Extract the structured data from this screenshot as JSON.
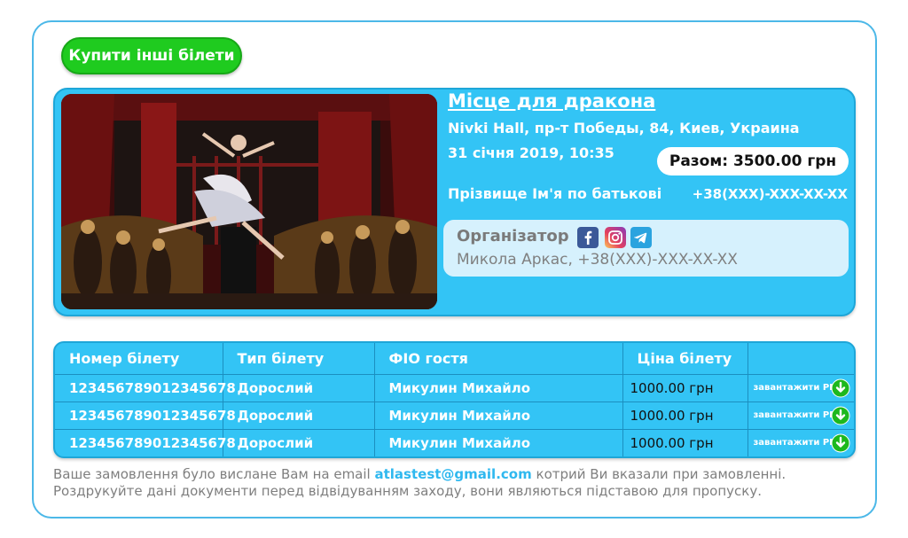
{
  "actions": {
    "buy_other_label": "Купити інші білети"
  },
  "event": {
    "title": "Місце для дракона",
    "address": "Nivki Hall, пр-т Победы, 84, Киев, Украина",
    "datetime": "31 січня 2019, 10:35",
    "total": "Разом: 3500.00 грн",
    "guest_name": "Прізвище Ім'я по батькові",
    "guest_phone": "+38(XXX)-XXX-XX-XX",
    "image_icon": "ballet-performance-photo"
  },
  "organizer": {
    "label": "Організатор",
    "contact": "Микола Аркас, +38(XXX)-XXX-XX-XX",
    "socials": [
      "facebook-icon",
      "instagram-icon",
      "telegram-icon"
    ]
  },
  "tickets": {
    "headers": [
      "Номер білету",
      "Тип білету",
      "ФІО гостя",
      "Ціна білету",
      ""
    ],
    "download_label": "завантажити PDF",
    "rows": [
      {
        "number": "123456789012345678",
        "type": "Дорослий",
        "guest": "Микулин Михайло",
        "price": "1000.00 грн"
      },
      {
        "number": "123456789012345678",
        "type": "Дорослий",
        "guest": "Микулин Михайло",
        "price": "1000.00 грн"
      },
      {
        "number": "123456789012345678",
        "type": "Дорослий",
        "guest": "Микулин Михайло",
        "price": "1000.00 грн"
      }
    ]
  },
  "notice": {
    "line1_before": "Ваше замовлення було вислане Вам на email",
    "email": "atlastest@gmail.com",
    "line1_after": "котрий Ви вказали при замовленні.",
    "line2": "Роздрукуйте дані документи перед відвідуванням заходу, вони являються підставою для пропуску."
  },
  "colors": {
    "accent": "#33c4f5",
    "button_green": "#1fcb1f",
    "organizer_bg": "#d6f1fd",
    "link": "#2fb8ef"
  }
}
